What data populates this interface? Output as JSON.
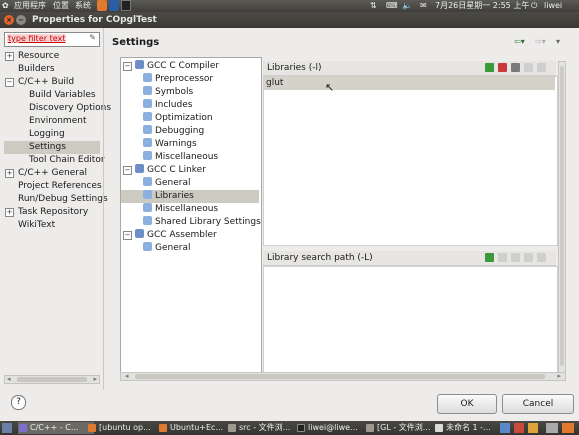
{
  "top_panel": {
    "menu_apps": "应用程序",
    "menu_places": "位置",
    "menu_system": "系统",
    "datetime": "7月26日星期一  2:55 上午",
    "user": "liwei"
  },
  "window": {
    "title": "Properties for COpglTest"
  },
  "nav": {
    "filter_text": "type filter text",
    "items": [
      {
        "label": "Resource",
        "expander": "+"
      },
      {
        "label": "Builders",
        "expander": ""
      },
      {
        "label": "C/C++ Build",
        "expander": "−"
      },
      {
        "label": "Build Variables",
        "expander": ""
      },
      {
        "label": "Discovery Options",
        "expander": ""
      },
      {
        "label": "Environment",
        "expander": ""
      },
      {
        "label": "Logging",
        "expander": ""
      },
      {
        "label": "Settings",
        "expander": ""
      },
      {
        "label": "Tool Chain Editor",
        "expander": ""
      },
      {
        "label": "C/C++ General",
        "expander": "+"
      },
      {
        "label": "Project References",
        "expander": ""
      },
      {
        "label": "Run/Debug Settings",
        "expander": ""
      },
      {
        "label": "Task Repository",
        "expander": "+"
      },
      {
        "label": "WikiText",
        "expander": ""
      }
    ]
  },
  "settings": {
    "title": "Settings",
    "tools": [
      {
        "label": "GCC C Compiler"
      },
      {
        "label": "Preprocessor"
      },
      {
        "label": "Symbols"
      },
      {
        "label": "Includes"
      },
      {
        "label": "Optimization"
      },
      {
        "label": "Debugging"
      },
      {
        "label": "Warnings"
      },
      {
        "label": "Miscellaneous"
      },
      {
        "label": "GCC C Linker"
      },
      {
        "label": "General"
      },
      {
        "label": "Libraries"
      },
      {
        "label": "Miscellaneous"
      },
      {
        "label": "Shared Library Settings"
      },
      {
        "label": "GCC Assembler"
      },
      {
        "label": "General"
      }
    ],
    "libraries_header": "Libraries (-l)",
    "libraries": [
      "glut"
    ],
    "search_path_header": "Library search path (-L)"
  },
  "buttons": {
    "ok": "OK",
    "cancel": "Cancel",
    "help": "?"
  },
  "taskbar": {
    "items": [
      {
        "label": "C/C++ - C..."
      },
      {
        "label": "[ubuntu op..."
      },
      {
        "label": "Ubuntu+Ec..."
      },
      {
        "label": "src - 文件浏..."
      },
      {
        "label": "liwei@liwe..."
      },
      {
        "label": "[GL - 文件浏..."
      },
      {
        "label": "未命名 1 -..."
      }
    ]
  },
  "colors": {
    "panel": "#3c3b37",
    "dialog": "#edeceb",
    "selection": "#cdcac1",
    "accent_orange": "#e07a2f"
  }
}
